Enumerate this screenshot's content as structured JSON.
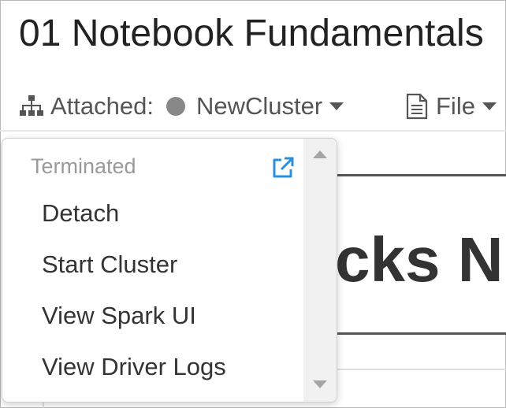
{
  "notebook": {
    "title": "01 Notebook Fundamentals"
  },
  "toolbar": {
    "attached_label": "Attached:",
    "cluster_name": "NewCluster",
    "file_label": "File"
  },
  "cell": {
    "heading_fragment": "cks N"
  },
  "cluster_menu": {
    "status": "Terminated",
    "items": [
      {
        "label": "Detach"
      },
      {
        "label": "Start Cluster"
      },
      {
        "label": "View Spark UI"
      },
      {
        "label": "View Driver Logs"
      }
    ]
  },
  "colors": {
    "link_blue": "#2b8fdc",
    "status_dot": "#888888"
  },
  "icons": {
    "cluster": "cluster-hierarchy-icon",
    "file": "file-icon",
    "external": "external-link-icon"
  }
}
